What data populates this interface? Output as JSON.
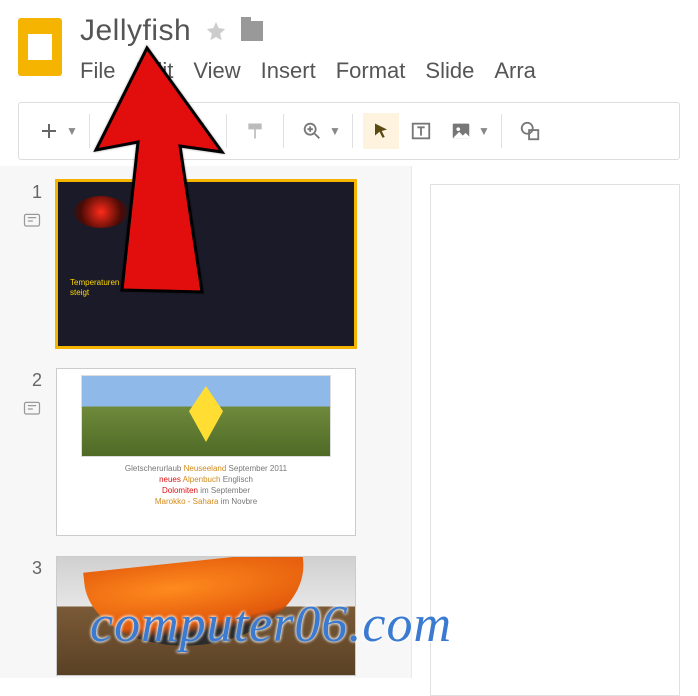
{
  "doc": {
    "title": "Jellyfish"
  },
  "menu": {
    "file": "File",
    "edit": "Edit",
    "view": "View",
    "insert": "Insert",
    "format": "Format",
    "slide": "Slide",
    "arrange": "Arra"
  },
  "slides": {
    "n1": "1",
    "n2": "2",
    "n3": "3",
    "s1_caption": "Temperaturen vorra\nsteigt",
    "s2_line1_a": "Gletscherurlaub",
    "s2_line1_b": "Neuseeland",
    "s2_line1_c": "September 2011",
    "s2_line2_a": "neues",
    "s2_line2_b": "Alpenbuch",
    "s2_line2_c": "Englisch",
    "s2_line3_a": "Dolomiten",
    "s2_line3_b": "im September",
    "s2_line4_a": "Marokko - Sahara",
    "s2_line4_b": "im Novbre"
  },
  "watermark": "computer06.com"
}
